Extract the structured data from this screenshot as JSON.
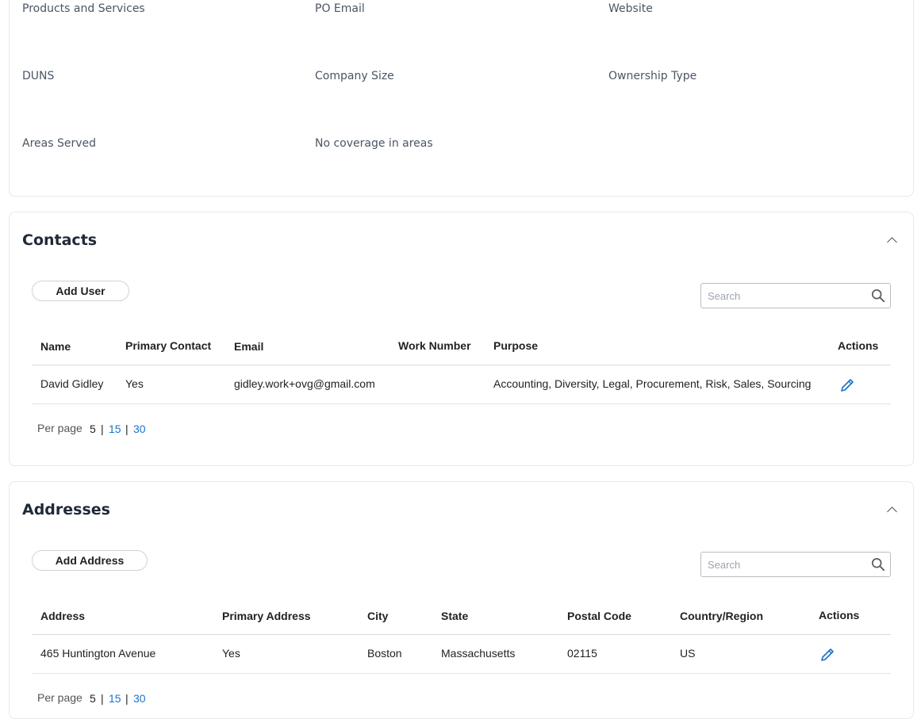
{
  "info": {
    "labels": [
      "Products and Services",
      "PO Email",
      "Website",
      "DUNS",
      "Company Size",
      "Ownership Type",
      "Areas Served",
      "No coverage in areas"
    ]
  },
  "contacts": {
    "title": "Contacts",
    "add_button": "Add User",
    "search_placeholder": "Search",
    "columns": [
      "Name",
      "Primary Contact",
      "Email",
      "Work Number",
      "Purpose",
      "Actions"
    ],
    "rows": [
      {
        "name": "David Gidley",
        "primary": "Yes",
        "email": "gidley.work+ovg@gmail.com",
        "work_number": "",
        "purpose": "Accounting, Diversity, Legal, Procurement, Risk, Sales, Sourcing"
      }
    ],
    "per_page_label": "Per page",
    "per_page_options": [
      "5",
      "15",
      "30"
    ],
    "per_page_separator": "|"
  },
  "addresses": {
    "title": "Addresses",
    "add_button": "Add Address",
    "search_placeholder": "Search",
    "columns": [
      "Address",
      "Primary Address",
      "City",
      "State",
      "Postal Code",
      "Country/Region",
      "Actions"
    ],
    "rows": [
      {
        "address": "465 Huntington Avenue",
        "primary": "Yes",
        "city": "Boston",
        "state": "Massachusetts",
        "postal": "02115",
        "country": "US"
      }
    ],
    "per_page_label": "Per page",
    "per_page_options": [
      "5",
      "15",
      "30"
    ],
    "per_page_separator": "|"
  },
  "colors": {
    "link": "#1a73c8",
    "edit_icon": "#1a73c8",
    "border": "#e8e8ea"
  },
  "icons": {
    "search": "search-icon",
    "edit": "pencil-icon",
    "collapse": "chevron-up-icon"
  }
}
